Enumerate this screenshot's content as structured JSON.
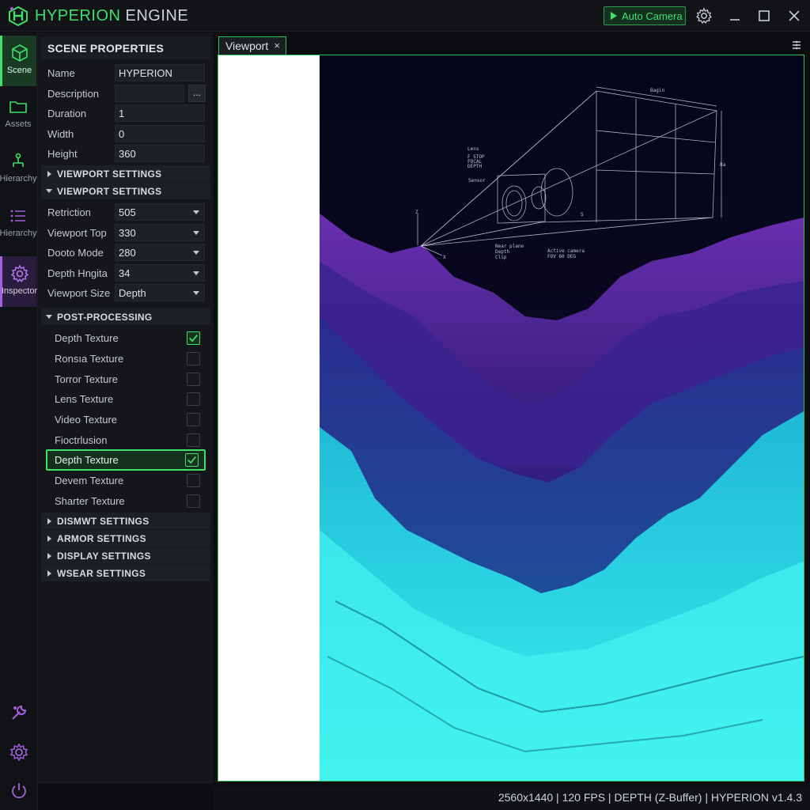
{
  "app": {
    "title_accent": "HYPERION",
    "title_rest": " ENGINE",
    "auto_camera_label": "Auto Camera"
  },
  "rail": {
    "items": [
      {
        "label": "Scene",
        "icon": "cube-icon"
      },
      {
        "label": "Assets",
        "icon": "folder-icon"
      },
      {
        "label": "Hierarchy",
        "icon": "hierarchy-tree-icon"
      },
      {
        "label": "Hierarchy",
        "icon": "list-icon"
      },
      {
        "label": "Inspector",
        "icon": "gear-icon"
      }
    ],
    "bottom_icons": [
      "wrench-icon",
      "settings-icon",
      "power-icon"
    ]
  },
  "panel": {
    "header": "SCENE PROPERTIES",
    "properties": [
      {
        "label": "Name",
        "value": "HYPERION"
      },
      {
        "label": "Description",
        "value": "",
        "button": "..."
      },
      {
        "label": "Duration",
        "value": "1"
      },
      {
        "label": "Width",
        "value": "0"
      },
      {
        "label": "Height",
        "value": "360"
      }
    ],
    "sections": {
      "viewport_collapsed": "VIEWPORT SETTINGS",
      "viewport_expanded": "VIEWPORT SETTINGS",
      "post_processing": "POST-PROCESSING",
      "dismwt": "DISMWT SETTINGS",
      "armor": "ARMOR SETTINGS",
      "display": "DISPLAY SETTINGS",
      "wsear": "WSEAR SETTINGS"
    },
    "viewport_settings": [
      {
        "label": "Retriction",
        "value": "505"
      },
      {
        "label": "Viewport Top",
        "value": "330"
      },
      {
        "label": "Dooto Mode",
        "value": "280"
      },
      {
        "label": "Depth Hngita",
        "value": "34"
      },
      {
        "label": "Viewport Size",
        "value": "Depth"
      }
    ],
    "post_processing": [
      {
        "label": "Depth Texture",
        "checked": true
      },
      {
        "label": "Ronsıa Texture",
        "checked": false
      },
      {
        "label": "Torror Texture",
        "checked": false
      },
      {
        "label": "Lens Texture",
        "checked": false
      },
      {
        "label": "Video Texture",
        "checked": false
      },
      {
        "label": "Fioctrlusion",
        "checked": false
      },
      {
        "label": "Depth Texture",
        "checked": true,
        "highlighted": true
      },
      {
        "label": "Devem Texture",
        "checked": false
      },
      {
        "label": "Sharter Texture",
        "checked": false
      }
    ]
  },
  "viewport": {
    "tab_label": "Viewport",
    "close_glyph": "×",
    "diagram_labels": {
      "top": "Bagin",
      "right": "Ba",
      "left_block": [
        "Lens",
        "F STOP",
        "FOCAL",
        "DEPTH"
      ],
      "sensor": "Sensor",
      "bottom_left": [
        "Near plane",
        "Depth",
        "Clip"
      ],
      "bottom_right": [
        "Active camera",
        "FOV 60 DEG"
      ],
      "axis_z": "Z",
      "axis_x": "X",
      "s_mark": "S"
    },
    "colors": {
      "sky": "#07081a",
      "mountain_far": "#4a2a8c",
      "mountain_mid": "#2c2f8a",
      "terrain": "#2be0e0",
      "terrain_dark": "#1a7f9a"
    }
  },
  "status": {
    "text": "2560x1440 | 120 FPS | DEPTH (Z-Buffer) | HYPERION v1.4.3"
  }
}
